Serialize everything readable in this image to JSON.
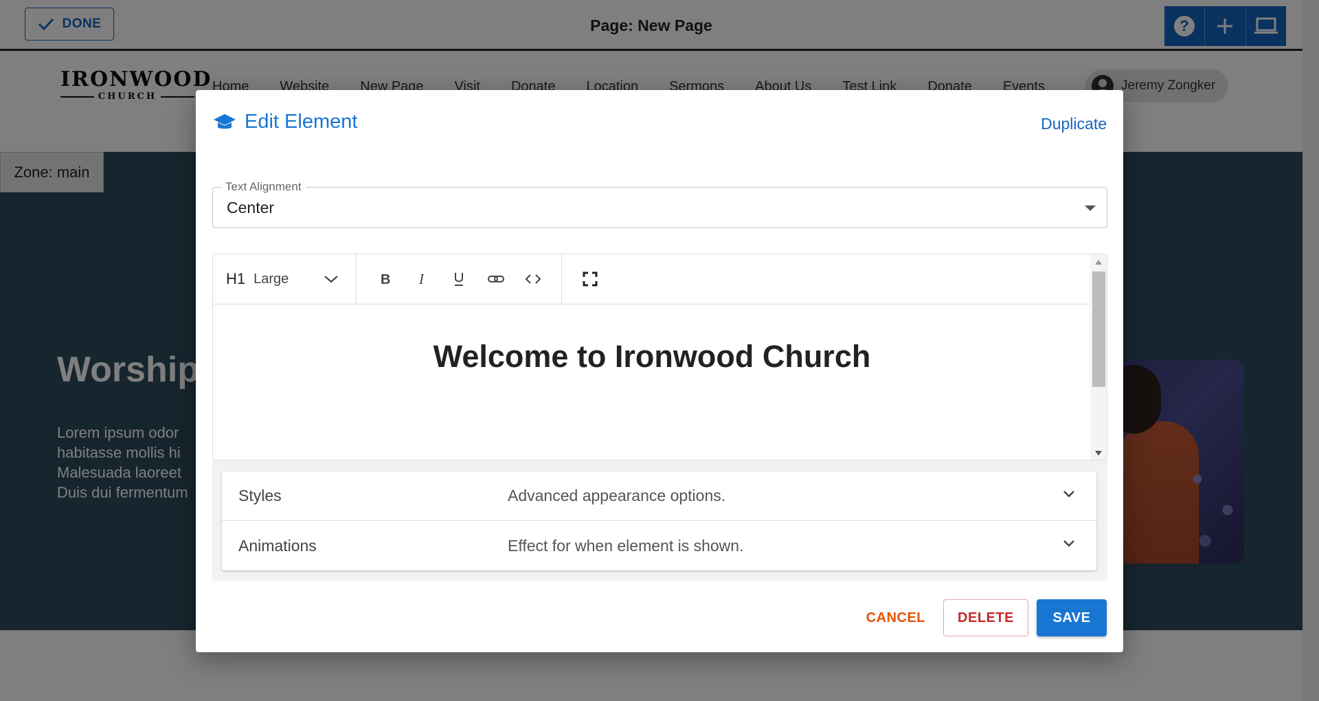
{
  "topbar": {
    "done_label": "DONE",
    "page_title": "Page: New Page",
    "tools": [
      {
        "icon": "help-icon"
      },
      {
        "icon": "plus-icon"
      },
      {
        "icon": "laptop-icon"
      }
    ]
  },
  "site": {
    "logo_main": "IRONWOOD",
    "logo_sub": "CHURCH",
    "nav": [
      "Home",
      "Website",
      "New Page",
      "Visit",
      "Donate",
      "Location",
      "Sermons",
      "About Us",
      "Test Link",
      "Donate",
      "Events"
    ],
    "user_name": "Jeremy Zongker",
    "zone_label": "Zone: main",
    "hero_title": "Worship",
    "hero_text": [
      "Lorem ipsum odor",
      "habitasse mollis hi",
      "Malesuada laoreet",
      "Duis dui fermentum"
    ]
  },
  "modal": {
    "title": "Edit Element",
    "title_icon": "graduation-cap-icon",
    "duplicate_label": "Duplicate",
    "text_alignment": {
      "label": "Text Alignment",
      "value": "Center"
    },
    "editor": {
      "heading_tag": "H1",
      "heading_size": "Large",
      "format_buttons": [
        "bold-icon",
        "italic-icon",
        "underline-icon",
        "link-icon",
        "code-icon"
      ],
      "fullscreen_icon": "fullscreen-icon",
      "content_heading": "Welcome to Ironwood Church"
    },
    "accordions": [
      {
        "title": "Styles",
        "description": "Advanced appearance options."
      },
      {
        "title": "Animations",
        "description": "Effect for when element is shown."
      }
    ],
    "actions": {
      "cancel": "CANCEL",
      "delete": "DELETE",
      "save": "SAVE"
    }
  },
  "colors": {
    "primary": "#1976d2",
    "cancel": "#e65100",
    "delete": "#c62828",
    "hero_bg": "#2e4a5c"
  }
}
